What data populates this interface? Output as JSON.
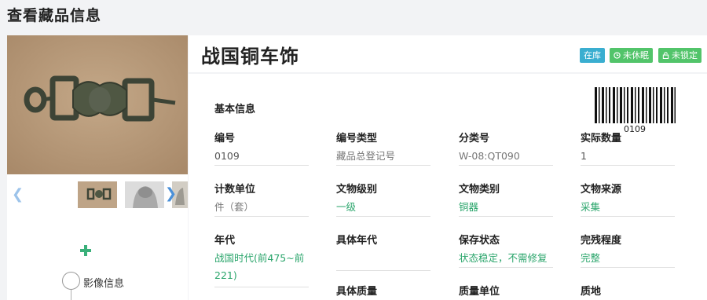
{
  "page": {
    "title": "查看藏品信息"
  },
  "item": {
    "name": "战国铜车饰"
  },
  "badges": {
    "stock": "在库",
    "sleep": "未休眠",
    "lock": "未锁定"
  },
  "section": {
    "basic_info": "基本信息"
  },
  "barcode": {
    "number": "0109"
  },
  "timeline": {
    "media_label": "影像信息"
  },
  "fields": {
    "bianhao": {
      "label": "编号",
      "value": "0109"
    },
    "bianhao_type": {
      "label": "编号类型",
      "value": "藏品总登记号"
    },
    "fenlei": {
      "label": "分类号",
      "value": "W-08:QT090"
    },
    "shiji_shuliang": {
      "label": "实际数量",
      "value": "1"
    },
    "jishu_danwei": {
      "label": "计数单位",
      "value": "件（套）"
    },
    "wenwu_jibie": {
      "label": "文物级别",
      "value": "一级"
    },
    "wenwu_leibie": {
      "label": "文物类别",
      "value": "铜器"
    },
    "wenwu_laiyuan": {
      "label": "文物来源",
      "value": "采集"
    },
    "niandai": {
      "label": "年代",
      "value": "战国时代(前475~前221)"
    },
    "juti_niandai": {
      "label": "具体年代",
      "value": ""
    },
    "baocun": {
      "label": "保存状态",
      "value": "状态稳定，不需修复"
    },
    "wancan": {
      "label": "完残程度",
      "value": "完整"
    },
    "juti_zhiliang": {
      "label": "具体质量"
    },
    "zhiliang_danwei": {
      "label": "质量单位"
    },
    "zhidi": {
      "label": "质地"
    }
  }
}
